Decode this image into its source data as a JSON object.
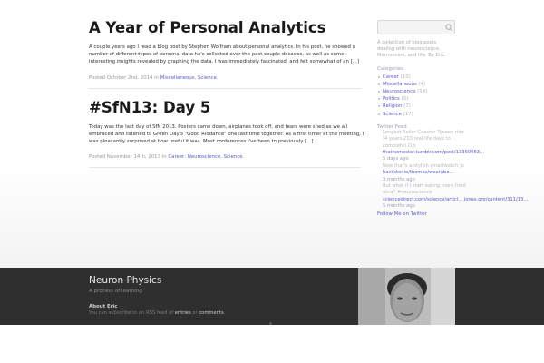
{
  "posts": [
    {
      "title": "A Year of Personal Analytics",
      "excerpt": "A couple years ago I read a blog post by Stephen Wolfram about personal analytics. In his post, he showed a number of different types of personal data he's collected over the past couple decades, as well as some interesting insights revealed by graphing the data. I was immediately fascinated, and felt somewhat of an [...]",
      "meta_prefix": "Posted October 2nd, 2014 in ",
      "categories": [
        "Miscellaneous",
        "Science"
      ]
    },
    {
      "title": "#SfN13: Day 5",
      "excerpt": "Today was the last day of SfN 2013. Posters came down, airplanes took off, and tears were shed as we all embraced and listened to Green Day's \"Good Riddance\" one last time together. As a first timer at the meeting, I was pleasantly surprised at how useful it was. Most conferences I've been to previously [...]",
      "meta_prefix": "Posted November 14th, 2013 in ",
      "categories": [
        "Career",
        "Neuroscience",
        "Science"
      ]
    }
  ],
  "sidebar": {
    "search_placeholder": "",
    "about": "A collection of blog posts dealing with neuroscience, Mormonism, and life. By Eric.",
    "categories_heading": "Categories",
    "categories": [
      {
        "name": "Career",
        "count": "(10)"
      },
      {
        "name": "Miscellaneous",
        "count": "(4)"
      },
      {
        "name": "Neuroscience",
        "count": "(14)"
      },
      {
        "name": "Politics",
        "count": "(3)"
      },
      {
        "name": "Religion",
        "count": "(7)"
      },
      {
        "name": "Science",
        "count": "(17)"
      }
    ],
    "twitter_heading": "Twitter Feed",
    "tweets": [
      {
        "text": "Longest Roller Coaster Tycoon ride (4 years 210 real-life days to complete) O.o",
        "link": "thathomestar.tumblr.com/post/13360463...",
        "time": "5 days ago"
      },
      {
        "text": "Now that's a stylish smartwatch ;p",
        "link": "hackster.io/thomas/wearabo...",
        "time": "3 months ago"
      },
      {
        "text": "But what if I start eating more fried okra? #neuroscience",
        "link": "sciencedirect.com/science/articl... jonas.org/content/311/13...",
        "time": "5 months ago"
      }
    ],
    "follow_label": "Follow Me on Twitter"
  },
  "footer": {
    "site_title": "Neuron Physics",
    "tagline": "A process of learning",
    "about_heading": "About Eric",
    "rss_prefix": "You can subscribe to an RSS feed of ",
    "rss_entries": "entries",
    "rss_or": " or ",
    "rss_comments": "comments",
    "rss_suffix": "."
  },
  "colors": {
    "link": "#5a5acf",
    "footer_bg": "#2f2f2f"
  }
}
